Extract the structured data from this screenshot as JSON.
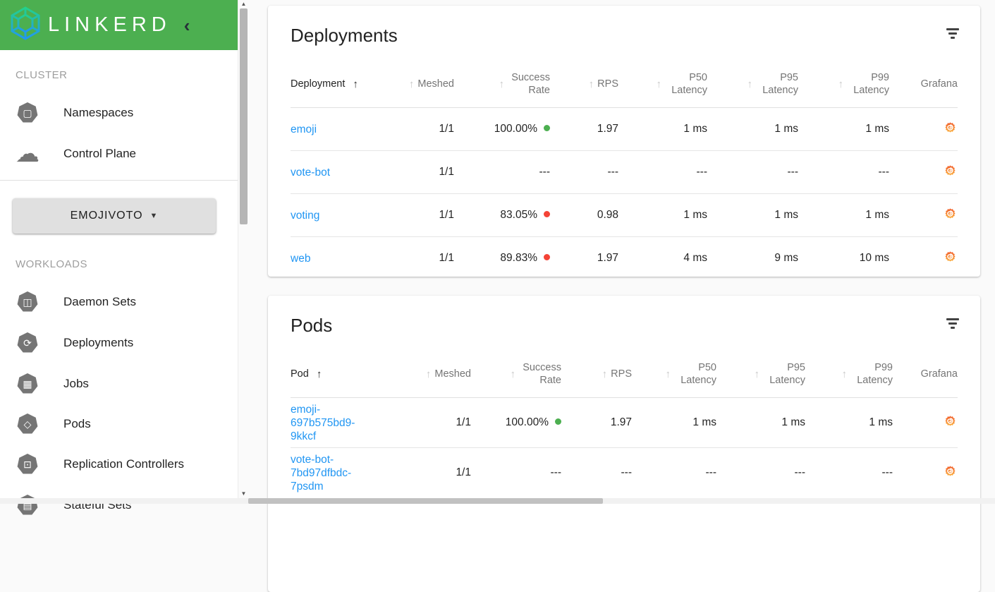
{
  "colors": {
    "app_bar_green": "#4caf50",
    "link_blue": "#2196f3",
    "status_good": "#4caf50",
    "status_bad": "#f44336",
    "grafana_orange": "#f15a29",
    "grafana_yellow": "#fbb03b"
  },
  "icons": {
    "sort_arrow": "↑",
    "caret_down": "▼",
    "chevron_left": "‹",
    "scroll_up_arrow": "▲",
    "scroll_down_arrow": "▼"
  },
  "sidebar": {
    "logo_text": "LINKERD",
    "cluster_section": {
      "label": "CLUSTER",
      "items": [
        {
          "label": "Namespaces",
          "glyph": "▢"
        },
        {
          "label": "Control Plane",
          "glyph": "☁"
        }
      ]
    },
    "namespace_button": {
      "label": "EMOJIVOTO"
    },
    "workloads_section": {
      "label": "WORKLOADS",
      "items": [
        {
          "label": "Daemon Sets",
          "glyph": "◫"
        },
        {
          "label": "Deployments",
          "glyph": "⟳"
        },
        {
          "label": "Jobs",
          "glyph": "▦"
        },
        {
          "label": "Pods",
          "glyph": "◇"
        },
        {
          "label": "Replication Controllers",
          "glyph": "⊡"
        },
        {
          "label": "Stateful Sets",
          "glyph": "▤"
        }
      ]
    }
  },
  "deployments": {
    "title": "Deployments",
    "columns": {
      "name": "Deployment",
      "meshed": "Meshed",
      "success": "Success Rate",
      "rps": "RPS",
      "p50": "P50 Latency",
      "p95": "P95 Latency",
      "p99": "P99 Latency",
      "grafana": "Grafana"
    },
    "rows": [
      {
        "name": "emoji",
        "meshed": "1/1",
        "success": "100.00%",
        "status": "good",
        "rps": "1.97",
        "p50": "1 ms",
        "p95": "1 ms",
        "p99": "1 ms"
      },
      {
        "name": "vote-bot",
        "meshed": "1/1",
        "success": "---",
        "status": "none",
        "rps": "---",
        "p50": "---",
        "p95": "---",
        "p99": "---"
      },
      {
        "name": "voting",
        "meshed": "1/1",
        "success": "83.05%",
        "status": "bad",
        "rps": "0.98",
        "p50": "1 ms",
        "p95": "1 ms",
        "p99": "1 ms"
      },
      {
        "name": "web",
        "meshed": "1/1",
        "success": "89.83%",
        "status": "bad",
        "rps": "1.97",
        "p50": "4 ms",
        "p95": "9 ms",
        "p99": "10 ms"
      }
    ]
  },
  "pods": {
    "title": "Pods",
    "columns": {
      "name": "Pod",
      "meshed": "Meshed",
      "success": "Success Rate",
      "rps": "RPS",
      "p50": "P50 Latency",
      "p95": "P95 Latency",
      "p99": "P99 Latency",
      "grafana": "Grafana"
    },
    "rows": [
      {
        "name": "emoji-697b575bd9-9kkcf",
        "meshed": "1/1",
        "success": "100.00%",
        "status": "good",
        "rps": "1.97",
        "p50": "1 ms",
        "p95": "1 ms",
        "p99": "1 ms"
      },
      {
        "name": "vote-bot-7bd97dfbdc-7psdm",
        "meshed": "1/1",
        "success": "---",
        "status": "none",
        "rps": "---",
        "p50": "---",
        "p95": "---",
        "p99": "---"
      }
    ]
  }
}
